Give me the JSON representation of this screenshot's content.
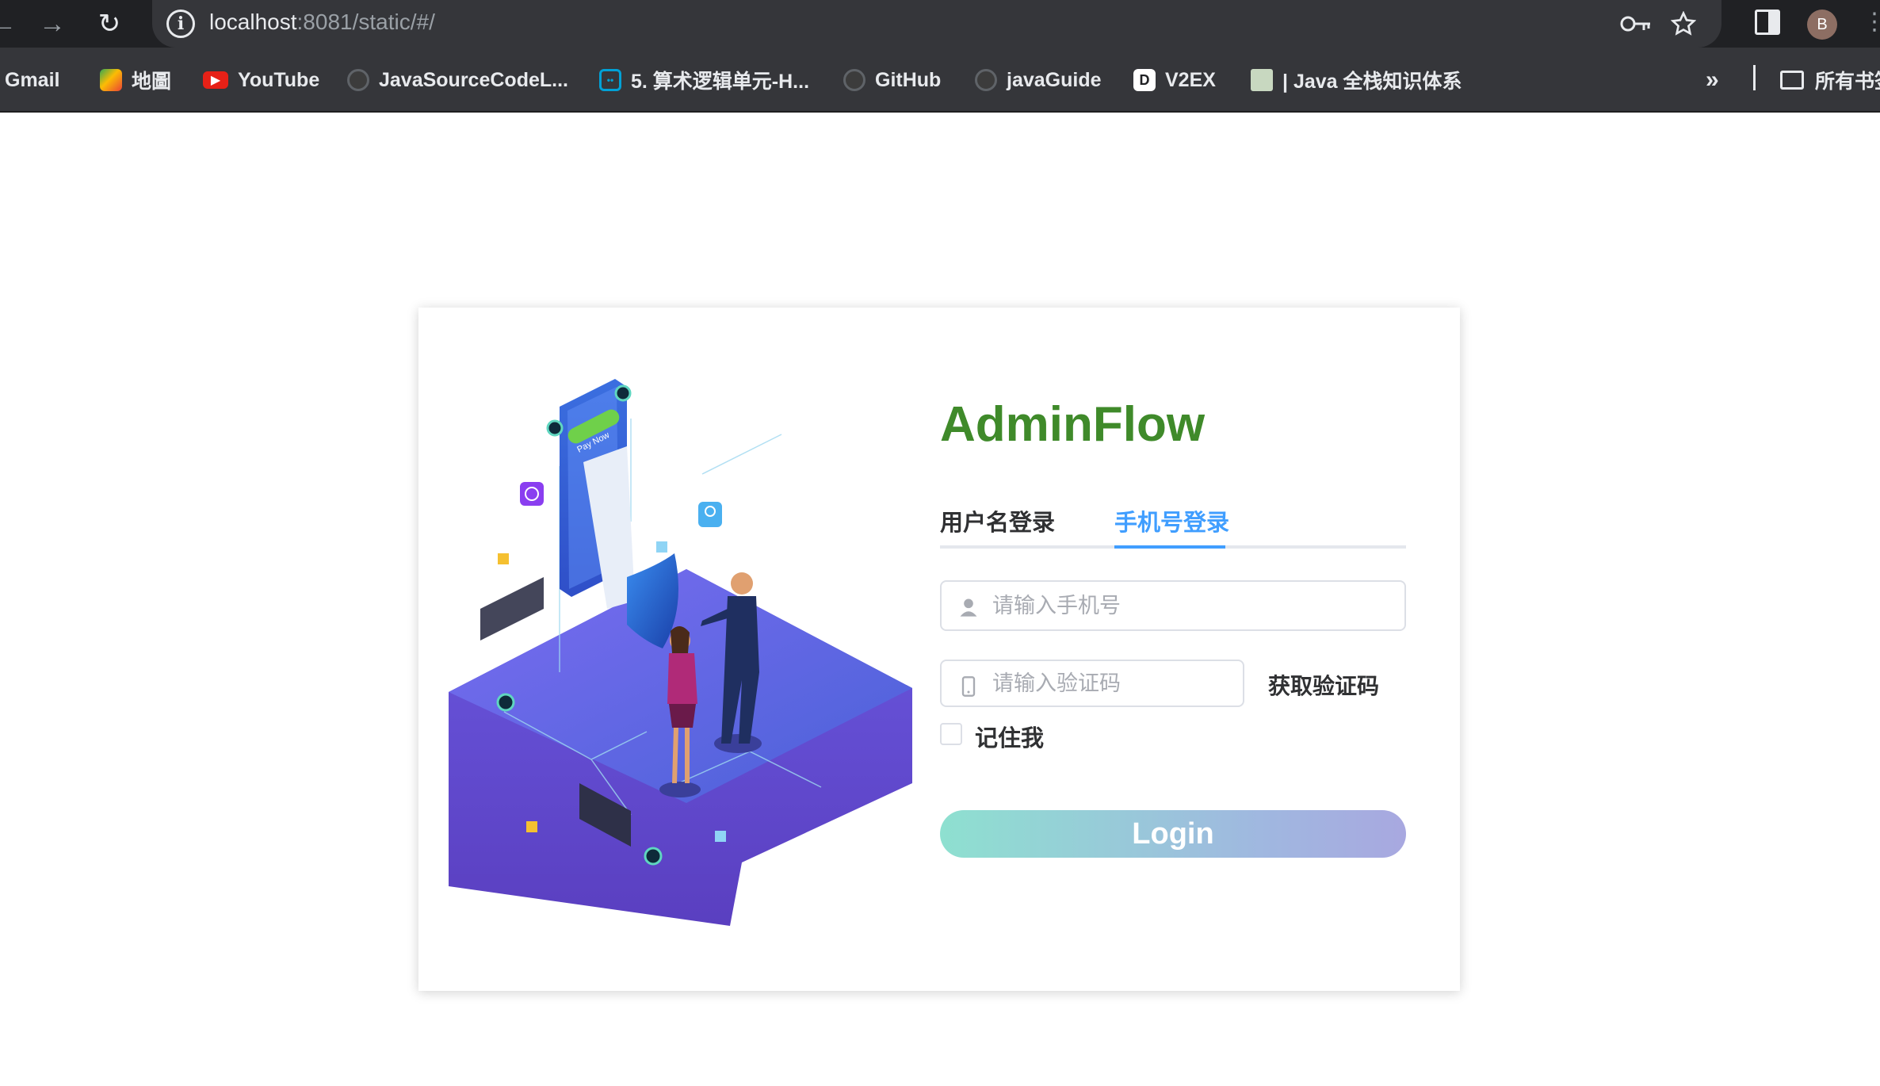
{
  "browser": {
    "url_host": "localhost",
    "url_rest": ":8081/static/#/",
    "avatar_letter": "B",
    "back_glyph": "←",
    "forward_glyph": "→",
    "reload_glyph": "↻",
    "info_glyph": "i"
  },
  "bookmarks": {
    "items": [
      {
        "label": "Gmail",
        "icon": "gmail-icon"
      },
      {
        "label": "地圖",
        "icon": "maps-icon"
      },
      {
        "label": "YouTube",
        "icon": "youtube-icon"
      },
      {
        "label": "JavaSourceCodeL...",
        "icon": "github-icon"
      },
      {
        "label": "5. 算术逻辑单元-H...",
        "icon": "bilibili-icon"
      },
      {
        "label": "GitHub",
        "icon": "github-icon"
      },
      {
        "label": "javaGuide",
        "icon": "github-icon"
      },
      {
        "label": "V2EX",
        "icon": "v2ex-icon"
      },
      {
        "label": "| Java 全栈知识体系",
        "icon": "java-site-icon"
      }
    ],
    "overflow_glyph": "»",
    "folder_label": "所有书签"
  },
  "login": {
    "app_title": "AdminFlow",
    "tabs": [
      {
        "label": "用户名登录",
        "active": false
      },
      {
        "label": "手机号登录",
        "active": true
      }
    ],
    "phone_placeholder": "请输入手机号",
    "code_placeholder": "请输入验证码",
    "get_code_label": "获取验证码",
    "remember_label": "记住我",
    "login_label": "Login",
    "illustration_badge_text": "Pay Now"
  },
  "colors": {
    "title_green": "#3f8a2a",
    "active_tab_blue": "#409eff",
    "button_gradient_start": "#8ee0d0",
    "button_gradient_end": "#a8a8e0"
  }
}
